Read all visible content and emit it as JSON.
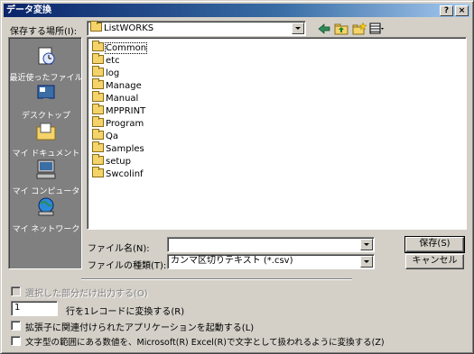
{
  "window": {
    "title": "データ変換",
    "help_glyph": "?",
    "close_glyph": "×"
  },
  "location": {
    "label": "保存する場所(I):",
    "value": "ListWORKS"
  },
  "places": [
    {
      "label": "最近使ったファイル",
      "icon": "recent-files-icon"
    },
    {
      "label": "デスクトップ",
      "icon": "desktop-icon"
    },
    {
      "label": "マイ ドキュメント",
      "icon": "my-documents-icon"
    },
    {
      "label": "マイ コンピュータ",
      "icon": "my-computer-icon"
    },
    {
      "label": "マイ ネットワーク",
      "icon": "my-network-icon"
    }
  ],
  "files": [
    "Common",
    "etc",
    "log",
    "Manage",
    "Manual",
    "MPPRINT",
    "Program",
    "Qa",
    "Samples",
    "setup",
    "Swcolinf"
  ],
  "filename": {
    "label": "ファイル名(N):",
    "value": ""
  },
  "filetype": {
    "label": "ファイルの種類(T):",
    "value": "カンマ区切りテキスト (*.csv)"
  },
  "buttons": {
    "save": "保存(S)",
    "cancel": "キャンセル"
  },
  "options": {
    "selected_only": "選択した部分だけ出力する(O)",
    "rows_value": "1",
    "rows_label": "行を1レコードに変換する(R)",
    "launch_app": "拡張子に関連付けられたアプリケーションを起動する(L)",
    "excel_text": "文字型の範囲にある数値を、Microsoft(R) Excel(R)で文字として扱われるように変換する(Z)"
  }
}
